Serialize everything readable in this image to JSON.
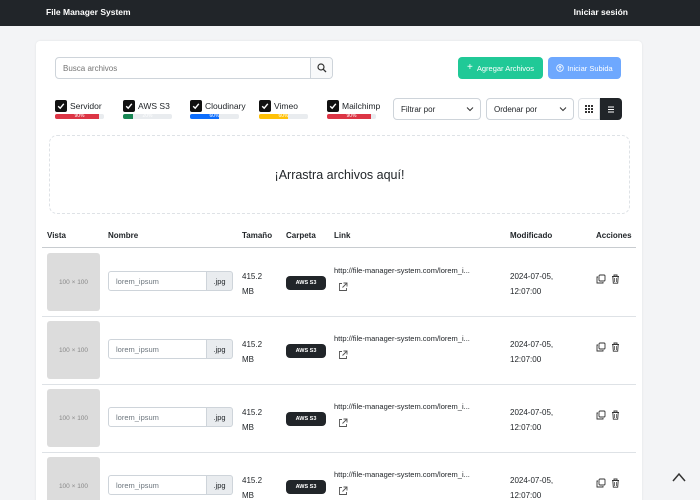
{
  "navbar": {
    "brand": "File Manager System",
    "login": "Iniciar sesión"
  },
  "search": {
    "placeholder": "Busca archivos"
  },
  "actions": {
    "add_label": "Agregar Archivos",
    "upload_label": "Iniciar Subida"
  },
  "storage": [
    {
      "label": "Servidor",
      "percent": "90%",
      "fill": 0.9,
      "color": "#dc3545"
    },
    {
      "label": "AWS S3",
      "percent": "20%",
      "fill": 0.2,
      "color": "#198754"
    },
    {
      "label": "Cloudinary",
      "percent": "60%",
      "fill": 0.6,
      "color": "#0d6efd"
    },
    {
      "label": "Vimeo",
      "percent": "60%",
      "fill": 0.6,
      "color": "#ffc107"
    },
    {
      "label": "Mailchimp",
      "percent": "90%",
      "fill": 0.9,
      "color": "#dc3545"
    }
  ],
  "filters": {
    "filter_label": "Filtrar por",
    "sort_label": "Ordenar por"
  },
  "dropzone": {
    "text": "¡Arrastra archivos aquí!"
  },
  "table": {
    "headers": {
      "view": "Vista",
      "name": "Nombre",
      "size": "Tamaño",
      "folder": "Carpeta",
      "link": "Link",
      "modified": "Modificado",
      "actions": "Acciones"
    },
    "rows": [
      {
        "thumb": "100 × 100",
        "name": "lorem_ipsum",
        "ext": ".jpg",
        "size1": "415.2",
        "size2": "MB",
        "folder": "AWS S3",
        "link": "http://file-manager-system.com/lorem_i...",
        "date": "2024-07-05,",
        "time": "12:07:00"
      },
      {
        "thumb": "100 × 100",
        "name": "lorem_ipsum",
        "ext": ".jpg",
        "size1": "415.2",
        "size2": "MB",
        "folder": "AWS S3",
        "link": "http://file-manager-system.com/lorem_i...",
        "date": "2024-07-05,",
        "time": "12:07:00"
      },
      {
        "thumb": "100 × 100",
        "name": "lorem_ipsum",
        "ext": ".jpg",
        "size1": "415.2",
        "size2": "MB",
        "folder": "AWS S3",
        "link": "http://file-manager-system.com/lorem_i...",
        "date": "2024-07-05,",
        "time": "12:07:00"
      },
      {
        "thumb": "100 × 100",
        "name": "lorem_ipsum",
        "ext": ".jpg",
        "size1": "415.2",
        "size2": "MB",
        "folder": "AWS S3",
        "link": "http://file-manager-system.com/lorem_i...",
        "date": "2024-07-05,",
        "time": "12:07:00"
      }
    ]
  }
}
